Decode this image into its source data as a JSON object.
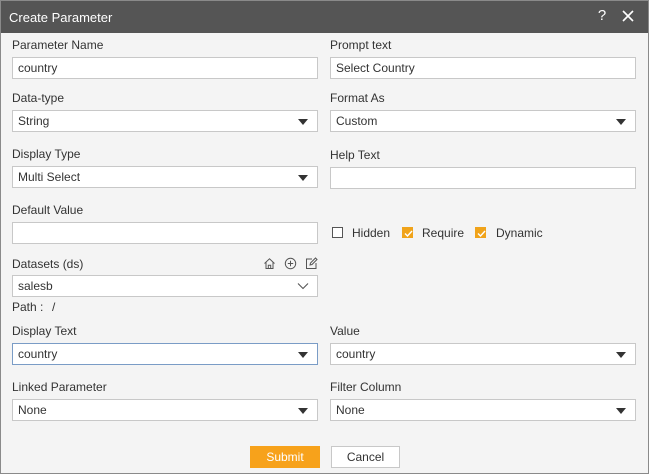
{
  "dialog": {
    "title": "Create Parameter",
    "help_glyph": "?",
    "close_glyph": "✕"
  },
  "fields": {
    "parameter_name": {
      "label": "Parameter Name",
      "value": "country"
    },
    "prompt_text": {
      "label": "Prompt text",
      "value": "Select Country"
    },
    "data_type": {
      "label": "Data-type",
      "value": "String"
    },
    "format_as": {
      "label": "Format As",
      "value": "Custom"
    },
    "display_type": {
      "label": "Display Type",
      "value": "Multi Select"
    },
    "help_text": {
      "label": "Help Text",
      "value": ""
    },
    "default_value": {
      "label": "Default Value",
      "value": ""
    },
    "datasets": {
      "label": "Datasets (ds)",
      "value": "salesb"
    },
    "path": {
      "label": "Path :",
      "value": "/"
    },
    "display_text": {
      "label": "Display Text",
      "value": "country"
    },
    "value": {
      "label": "Value",
      "value": "country"
    },
    "linked_parameter": {
      "label": "Linked Parameter",
      "value": "None"
    },
    "filter_column": {
      "label": "Filter Column",
      "value": "None"
    }
  },
  "options": {
    "hidden": {
      "label": "Hidden",
      "checked": false
    },
    "require": {
      "label": "Require",
      "checked": true
    },
    "dynamic": {
      "label": "Dynamic",
      "checked": true
    }
  },
  "datasets_icons": [
    "home-icon",
    "add-circle-icon",
    "edit-icon"
  ],
  "buttons": {
    "submit": "Submit",
    "cancel": "Cancel"
  },
  "colors": {
    "titlebar": "#555555",
    "accent": "#f7a21b",
    "background": "#f4f4f4"
  }
}
